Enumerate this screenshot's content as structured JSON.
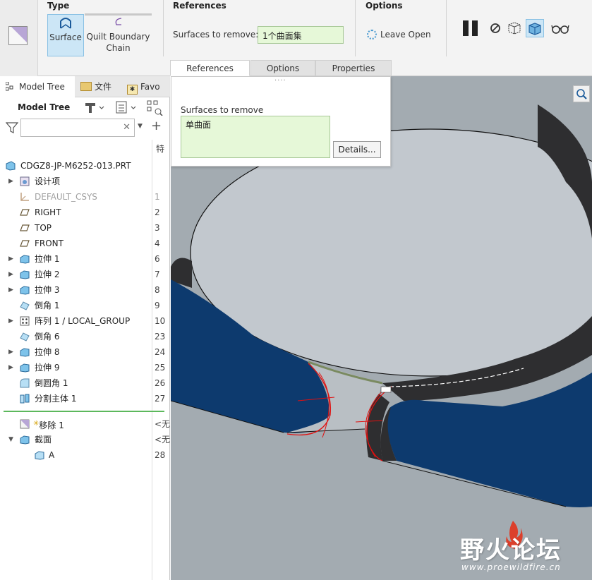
{
  "ribbon": {
    "type_title": "Type",
    "type_surface": "Surface",
    "type_quilt_1": "Quilt Boundary",
    "type_quilt_2": "Chain",
    "references_title": "References",
    "surfaces_label": "Surfaces to remove:",
    "surfaces_value": "1个曲面集",
    "options_title": "Options",
    "leave_open": "Leave Open"
  },
  "tabs": [
    "References",
    "Options",
    "Properties"
  ],
  "left_tabs": [
    "Model Tree",
    "文件",
    "Favo"
  ],
  "model_tree": {
    "title": "Model Tree",
    "col_head": "特",
    "rows": [
      {
        "label": "CDGZ8-JP-M6252-013.PRT",
        "num": "",
        "arrow": ""
      },
      {
        "label": "设计项",
        "num": "",
        "arrow": "▶"
      },
      {
        "label": "DEFAULT_CSYS",
        "num": "1",
        "arrow": ""
      },
      {
        "label": "RIGHT",
        "num": "2",
        "arrow": ""
      },
      {
        "label": "TOP",
        "num": "3",
        "arrow": ""
      },
      {
        "label": "FRONT",
        "num": "4",
        "arrow": ""
      },
      {
        "label": "拉伸 1",
        "num": "6",
        "arrow": "▶"
      },
      {
        "label": "拉伸 2",
        "num": "7",
        "arrow": "▶"
      },
      {
        "label": "拉伸 3",
        "num": "8",
        "arrow": "▶"
      },
      {
        "label": "倒角 1",
        "num": "9",
        "arrow": ""
      },
      {
        "label": "阵列 1 / LOCAL_GROUP",
        "num": "10",
        "arrow": "▶"
      },
      {
        "label": "倒角 6",
        "num": "23",
        "arrow": ""
      },
      {
        "label": "拉伸 8",
        "num": "24",
        "arrow": "▶"
      },
      {
        "label": "拉伸 9",
        "num": "25",
        "arrow": "▶"
      },
      {
        "label": "倒圆角 1",
        "num": "26",
        "arrow": ""
      },
      {
        "label": "分割主体 1",
        "num": "27",
        "arrow": ""
      },
      {
        "label": "移除 1",
        "num": "<无",
        "arrow": ""
      },
      {
        "label": "截面",
        "num": "<无",
        "arrow": "▼"
      },
      {
        "label": "A",
        "num": "28",
        "arrow": ""
      }
    ]
  },
  "popup": {
    "label": "Surfaces to remove",
    "item": "单曲面",
    "details": "Details..."
  },
  "watermark": {
    "main": "野火论坛",
    "url": "www.proewildfire.cn"
  },
  "colors": {
    "accent_blue": "#0b3d73",
    "active_bg": "#cce6f6",
    "collector_bg": "#e6f8d8",
    "viewport_bg": "#a3abb1"
  }
}
